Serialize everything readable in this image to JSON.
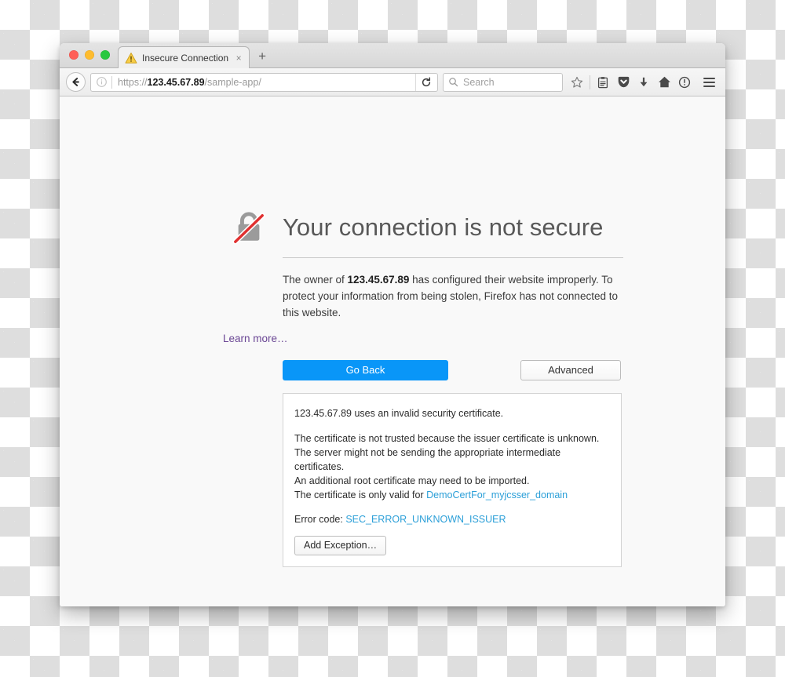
{
  "window": {
    "traffic_lights": [
      {
        "name": "close",
        "color": "#ff5f57"
      },
      {
        "name": "minimize",
        "color": "#febc2e"
      },
      {
        "name": "zoom",
        "color": "#28c840"
      }
    ]
  },
  "tabbar": {
    "tab_title": "Insecure Connection",
    "tab_icon": "warning-triangle-icon",
    "close_label": "×",
    "newtab_label": "+"
  },
  "toolbar": {
    "back_icon": "back-arrow-icon",
    "identity_icon": "info-circle-icon",
    "url_prefix": "https://",
    "url_host": "123.45.67.89",
    "url_path": "/sample-app/",
    "reload_icon": "reload-icon",
    "search_placeholder": "Search",
    "search_icon": "search-icon",
    "icons": [
      {
        "name": "bookmark-star-icon"
      },
      {
        "name": "library-icon"
      },
      {
        "name": "pocket-icon"
      },
      {
        "name": "downloads-icon"
      },
      {
        "name": "home-icon"
      },
      {
        "name": "sync-icon"
      }
    ],
    "menu_icon": "hamburger-menu-icon"
  },
  "error_page": {
    "lock_icon": "broken-lock-icon",
    "title": "Your connection is not secure",
    "body_prefix": "The owner of ",
    "body_host": "123.45.67.89",
    "body_suffix": " has configured their website improperly. To protect your information from being stolen, Firefox has not connected to this website.",
    "learn_more": "Learn more…",
    "go_back_label": "Go Back",
    "advanced_label": "Advanced",
    "accent_color": "#0996f8",
    "link_color": "#6a4694"
  },
  "cert_panel": {
    "summary": "123.45.67.89 uses an invalid security certificate.",
    "reason_1": "The certificate is not trusted because the issuer certificate is unknown.",
    "reason_2": "The server might not be sending the appropriate intermediate certificates.",
    "reason_3": "An additional root certificate may need to be imported.",
    "valid_for_prefix": "The certificate is only valid for ",
    "valid_for_domain": "DemoCertFor_myjcsser_domain",
    "error_code_label": "Error code: ",
    "error_code_value": "SEC_ERROR_UNKNOWN_ISSUER",
    "add_exception_label": "Add Exception…",
    "link_color": "#2b9fd8"
  }
}
